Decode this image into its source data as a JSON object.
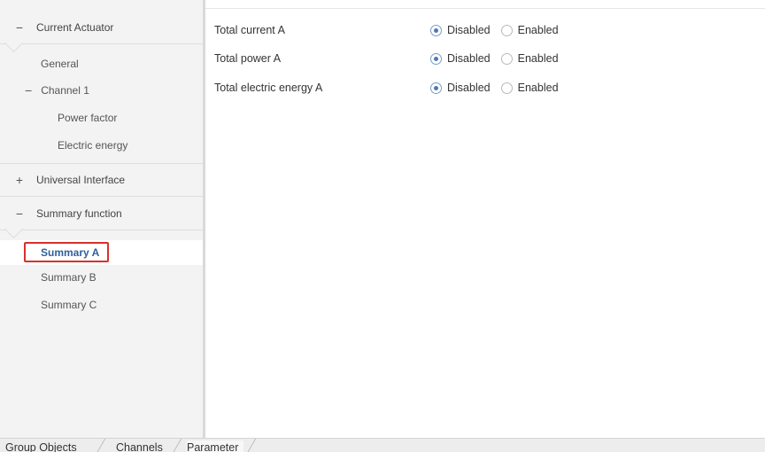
{
  "sidebar": {
    "sections": [
      {
        "toggle": "−",
        "label": "Current Actuator",
        "children": [
          {
            "label": "General"
          },
          {
            "toggle": "−",
            "label": "Channel 1"
          },
          {
            "label": "Power factor"
          },
          {
            "label": "Electric energy"
          }
        ]
      },
      {
        "toggle": "+",
        "label": "Universal Interface"
      },
      {
        "toggle": "−",
        "label": "Summary function",
        "children": [
          {
            "label": "Summary A",
            "selected": true
          },
          {
            "label": "Summary B"
          },
          {
            "label": "Summary C"
          }
        ]
      }
    ]
  },
  "parameters": [
    {
      "label": "Total current A",
      "options": [
        "Disabled",
        "Enabled"
      ],
      "selected": "Disabled"
    },
    {
      "label": "Total power A",
      "options": [
        "Disabled",
        "Enabled"
      ],
      "selected": "Disabled"
    },
    {
      "label": "Total electric energy A",
      "options": [
        "Disabled",
        "Enabled"
      ],
      "selected": "Disabled"
    }
  ],
  "tabs": [
    {
      "label": "Group Objects"
    },
    {
      "label": "Channels"
    },
    {
      "label": "Parameter",
      "active": true
    }
  ],
  "colors": {
    "selection_border": "#d9302c",
    "selection_text": "#2f5f9e",
    "radio_checked": "#4d79b3"
  }
}
